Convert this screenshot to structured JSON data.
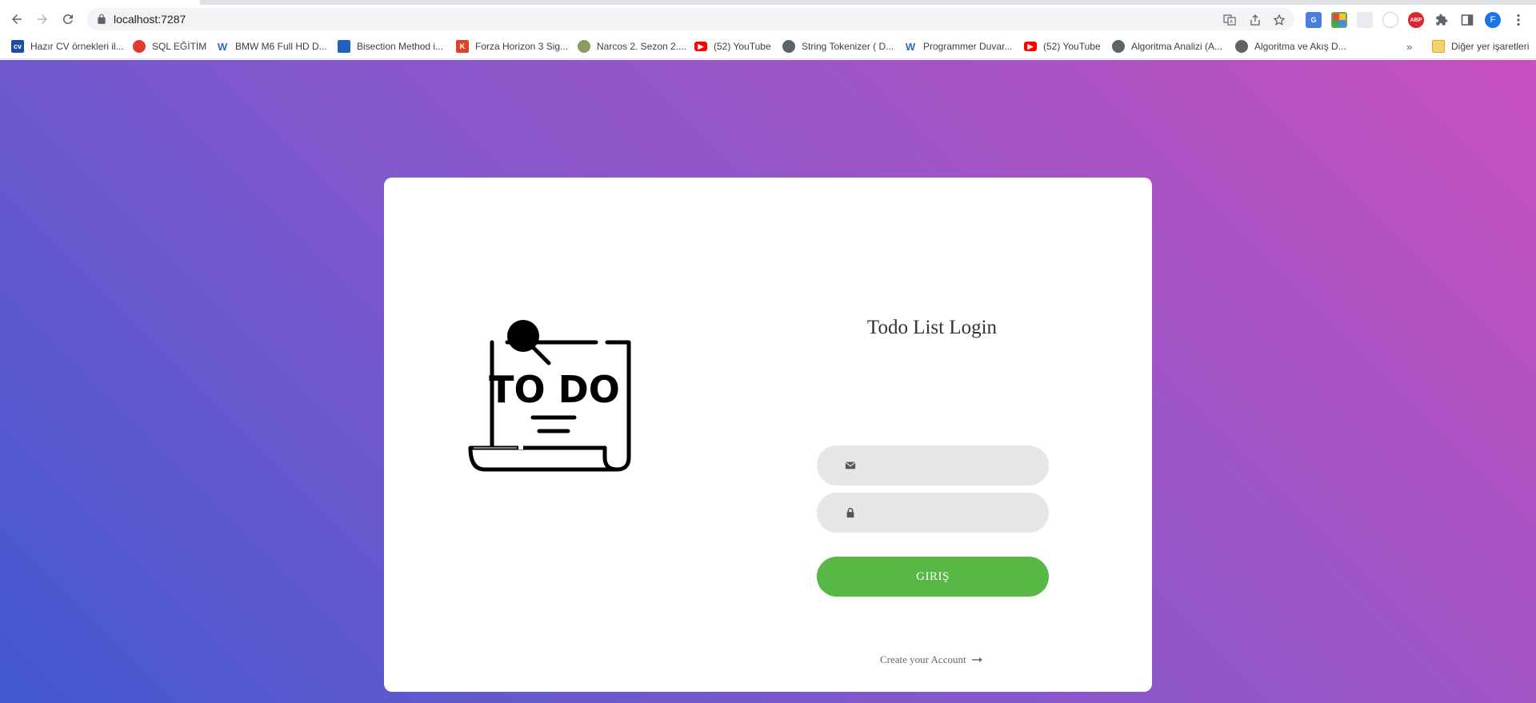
{
  "browser": {
    "url": "localhost:7287",
    "bookmarks": [
      {
        "label": "Hazır CV örnekleri il...",
        "icon": "cv-favicon-icon",
        "color": "#1a4fa3"
      },
      {
        "label": "SQL EĞİTİM",
        "icon": "database-favicon-icon",
        "color": "#e03a2f"
      },
      {
        "label": "BMW M6 Full HD D...",
        "icon": "wallpaper-favicon-icon",
        "color": "#2b6cc4"
      },
      {
        "label": "Bisection Method i...",
        "icon": "grid-favicon-icon",
        "color": "#2060c0"
      },
      {
        "label": "Forza Horizon 3 Sig...",
        "icon": "k-favicon-icon",
        "color": "#d9432b"
      },
      {
        "label": "Narcos 2. Sezon 2....",
        "icon": "narcos-favicon-icon",
        "color": "#8a9a60"
      },
      {
        "label": "(52) YouTube",
        "icon": "youtube-icon",
        "color": "#ff0000"
      },
      {
        "label": "String Tokenizer ( D...",
        "icon": "globe-icon",
        "color": "#5f6368"
      },
      {
        "label": "Programmer Duvar...",
        "icon": "wallpaper-favicon-icon",
        "color": "#2b6cc4"
      },
      {
        "label": "(52) YouTube",
        "icon": "youtube-icon",
        "color": "#ff0000"
      },
      {
        "label": "Algoritma Analizi (A...",
        "icon": "globe-icon",
        "color": "#5f6368"
      },
      {
        "label": "Algoritma ve Akış D...",
        "icon": "globe-icon",
        "color": "#5f6368"
      }
    ],
    "other_bookmarks": "Diğer yer işaretleri",
    "profile_initial": "F",
    "extensions": {
      "abp": "ABP"
    }
  },
  "illustration": {
    "text": "TO DO"
  },
  "login": {
    "title": "Todo List Login",
    "email_placeholder": "",
    "password_placeholder": "",
    "button_label": "GIRIŞ",
    "create_account_label": "Create your Account"
  },
  "colors": {
    "accent_green": "#57b846",
    "gradient_start": "#c850c0",
    "gradient_end": "#4158d0",
    "input_bg": "#e6e6e6"
  }
}
